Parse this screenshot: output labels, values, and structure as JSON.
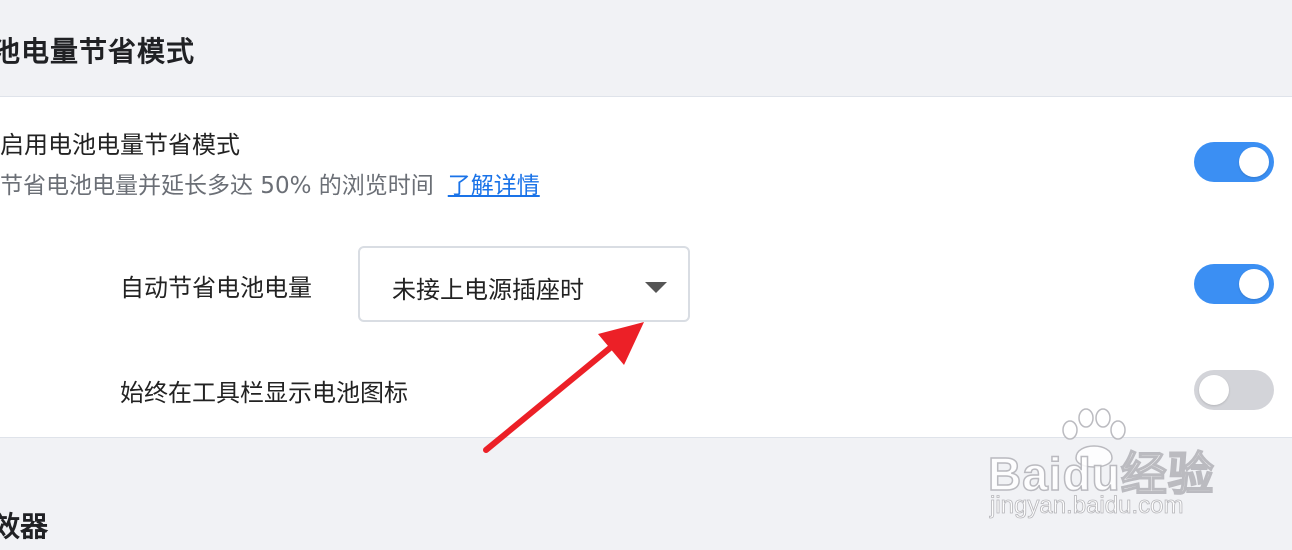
{
  "section": {
    "title": "池电量节省模式"
  },
  "battery_saver": {
    "title": "启用电池电量节省模式",
    "description": "节省电池电量并延长多达 50% 的浏览时间",
    "learn_more": "了解详情",
    "enabled": true
  },
  "auto_saver": {
    "label": "自动节省电池电量",
    "selected_option": "未接上电源插座时",
    "enabled": true
  },
  "toolbar_icon": {
    "label": "始终在工具栏显示电池图标",
    "enabled": false
  },
  "next_section": {
    "title": "效器"
  },
  "watermark": {
    "brand": "Baidu经验",
    "url": "jingyan.baidu.com"
  },
  "colors": {
    "accent": "#3b8ff3",
    "link": "#1a73e8",
    "toggle_off": "#d3d4d9",
    "annotation_arrow": "#ec2027"
  }
}
